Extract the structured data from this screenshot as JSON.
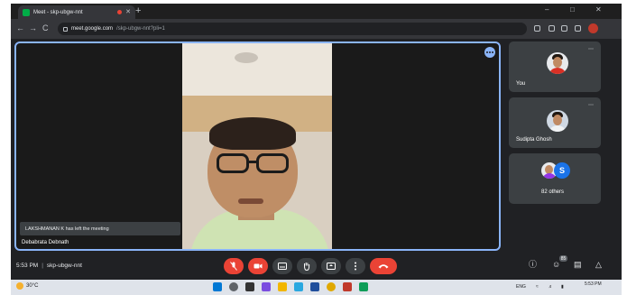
{
  "browser": {
    "tab_title": "Meet - skp-ubgw-nnt",
    "tab_close": "✕",
    "new_tab": "+",
    "window_controls": [
      "–",
      "□",
      "✕"
    ],
    "nav": {
      "back": "←",
      "forward": "→",
      "reload": "C"
    },
    "url_host": "meet.google.com",
    "url_path": "/skp-ubgw-nnt?pli=1"
  },
  "meet": {
    "main_tile": {
      "notice": "LAKSHMANAN K has left the meeting",
      "speaker_name": "Debabrata Debnath"
    },
    "side_tiles": [
      {
        "label": "You"
      },
      {
        "label": "Sudipta Ghosh"
      },
      {
        "label": "82 others",
        "letter": "S"
      }
    ],
    "tile_more_icon": "⋯",
    "bottom": {
      "time": "5:53 PM",
      "separator": "|",
      "meeting_code": "skp-ubgw-nnt",
      "people_count": "85"
    }
  },
  "taskbar": {
    "weather": "30°C",
    "tray_text": "ENG",
    "clock_time": "5:53 PM",
    "clock_date": ""
  },
  "colors": {
    "meet_bg": "#202124",
    "accent_blue": "#8ab4f8",
    "danger_red": "#ea4335",
    "tile_grey": "#3c4043"
  }
}
